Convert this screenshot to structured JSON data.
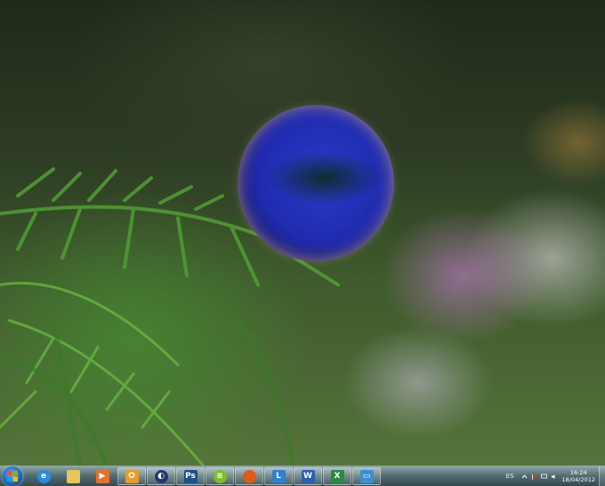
{
  "taskbar": {
    "pinned": [
      {
        "id": "ie",
        "icon": "internet-explorer-icon",
        "label": ""
      },
      {
        "id": "explorer",
        "icon": "folder-icon",
        "label": ""
      },
      {
        "id": "media",
        "icon": "media-player-icon",
        "label": ""
      },
      {
        "id": "outlook",
        "icon": "outlook-icon",
        "label": "O"
      },
      {
        "id": "app5",
        "icon": "app-circle-icon",
        "label": ""
      },
      {
        "id": "photoshop",
        "icon": "photoshop-icon",
        "label": "Ps"
      },
      {
        "id": "spotify",
        "icon": "spotify-icon",
        "label": ""
      },
      {
        "id": "firefox",
        "icon": "firefox-icon",
        "label": ""
      },
      {
        "id": "lync",
        "icon": "lync-icon",
        "label": "L"
      },
      {
        "id": "word",
        "icon": "word-icon",
        "label": "W"
      },
      {
        "id": "excel",
        "icon": "excel-icon",
        "label": "X"
      },
      {
        "id": "remote",
        "icon": "remote-desktop-icon",
        "label": ""
      }
    ],
    "tray": {
      "language": "ES",
      "time": "16:24",
      "date": "18/04/2012"
    }
  },
  "colors": {
    "ie": "#2a8de0",
    "folder": "#e8c45a",
    "media": "#e2732a",
    "outlook": "#e89a2a",
    "photoshop": "#1b4f8f",
    "spotify": "#7cbf2a",
    "firefox": "#e05a1a",
    "lync": "#2f7fc9",
    "word": "#2b5fb0",
    "excel": "#2a8a3e",
    "remote": "#3c8fd0"
  }
}
